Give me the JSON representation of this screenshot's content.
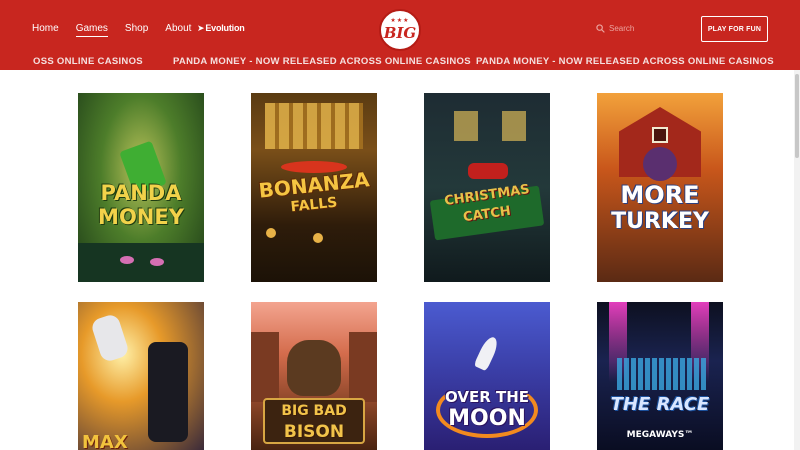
{
  "nav": {
    "items": [
      {
        "label": "Home"
      },
      {
        "label": "Games"
      },
      {
        "label": "Shop"
      },
      {
        "label": "About"
      }
    ],
    "evolution_label": "Evolution"
  },
  "logo": {
    "text": "BIG"
  },
  "search": {
    "placeholder": "Search"
  },
  "play_for_fun": "PLAY FOR FUN",
  "ticker": {
    "partial": "OSS ONLINE CASINOS",
    "message": "PANDA MONEY - NOW RELEASED ACROSS ONLINE CASINOS"
  },
  "games": [
    {
      "line1": "PANDA",
      "line2": "MONEY"
    },
    {
      "line1": "BONANZA",
      "line2": "FALLS"
    },
    {
      "line1": "CHRISTMAS",
      "line2": "CATCH"
    },
    {
      "line1": "MORE",
      "line2": "TURKEY"
    },
    {
      "line1": "MAX",
      "line2": ""
    },
    {
      "line1": "BIG BAD",
      "line2": "BISON"
    },
    {
      "line1": "OVER THE",
      "line2": "MOON"
    },
    {
      "line1": "THE RACE",
      "line2": "MEGAWAYS™"
    }
  ]
}
